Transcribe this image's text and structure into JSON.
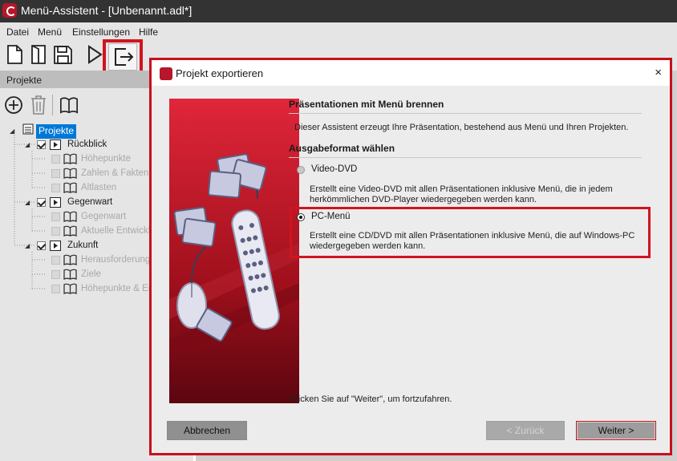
{
  "app": {
    "title": "Menü-Assistent - [Unbenannt.adl*]"
  },
  "menubar": [
    "Datei",
    "Menü",
    "Einstellungen",
    "Hilfe"
  ],
  "toolbar": {
    "icons": [
      "new-file-icon",
      "open-file-icon",
      "save-icon",
      "play-icon",
      "export-icon"
    ]
  },
  "panel": {
    "title": "Projekte",
    "tools": [
      "add-icon",
      "trash-icon",
      "book-icon"
    ]
  },
  "tree": {
    "root": "Projekte",
    "groups": [
      {
        "label": "Rückblick",
        "items": [
          "Höhepunkte",
          "Zahlen & Fakten",
          "Altlasten"
        ]
      },
      {
        "label": "Gegenwart",
        "items": [
          "Gegenwart",
          "Aktuelle Entwicklu"
        ]
      },
      {
        "label": "Zukunft",
        "items": [
          "Herausforderunge",
          "Ziele",
          "Höhepunkte & End"
        ]
      }
    ]
  },
  "dialog": {
    "title": "Projekt exportieren",
    "close": "×",
    "section1": "Präsentationen mit Menü brennen",
    "intro": "Dieser Assistent erzeugt Ihre Präsentation, bestehend aus Menü und Ihren Projekten.",
    "section2": "Ausgabeformat wählen",
    "options": [
      {
        "label": "Video-DVD",
        "selected": false,
        "desc1": "Erstellt eine Video-DVD mit allen Präsentationen inklusive Menü, die in jedem",
        "desc2": "herkömmlichen DVD-Player wiedergegeben werden kann."
      },
      {
        "label": "PC-Menü",
        "selected": true,
        "desc1": "Erstellt eine CD/DVD mit allen Präsentationen inklusive Menü, die auf Windows-PC",
        "desc2": "wiedergegeben werden kann."
      }
    ],
    "hint": "Klicken Sie auf \"Weiter\", um fortzufahren.",
    "buttons": {
      "cancel": "Abbrechen",
      "back": "< Zurück",
      "next": "Weiter >"
    }
  },
  "colors": {
    "highlight": "#d0141e",
    "selection": "#0078d7",
    "titlebar": "#333333"
  }
}
